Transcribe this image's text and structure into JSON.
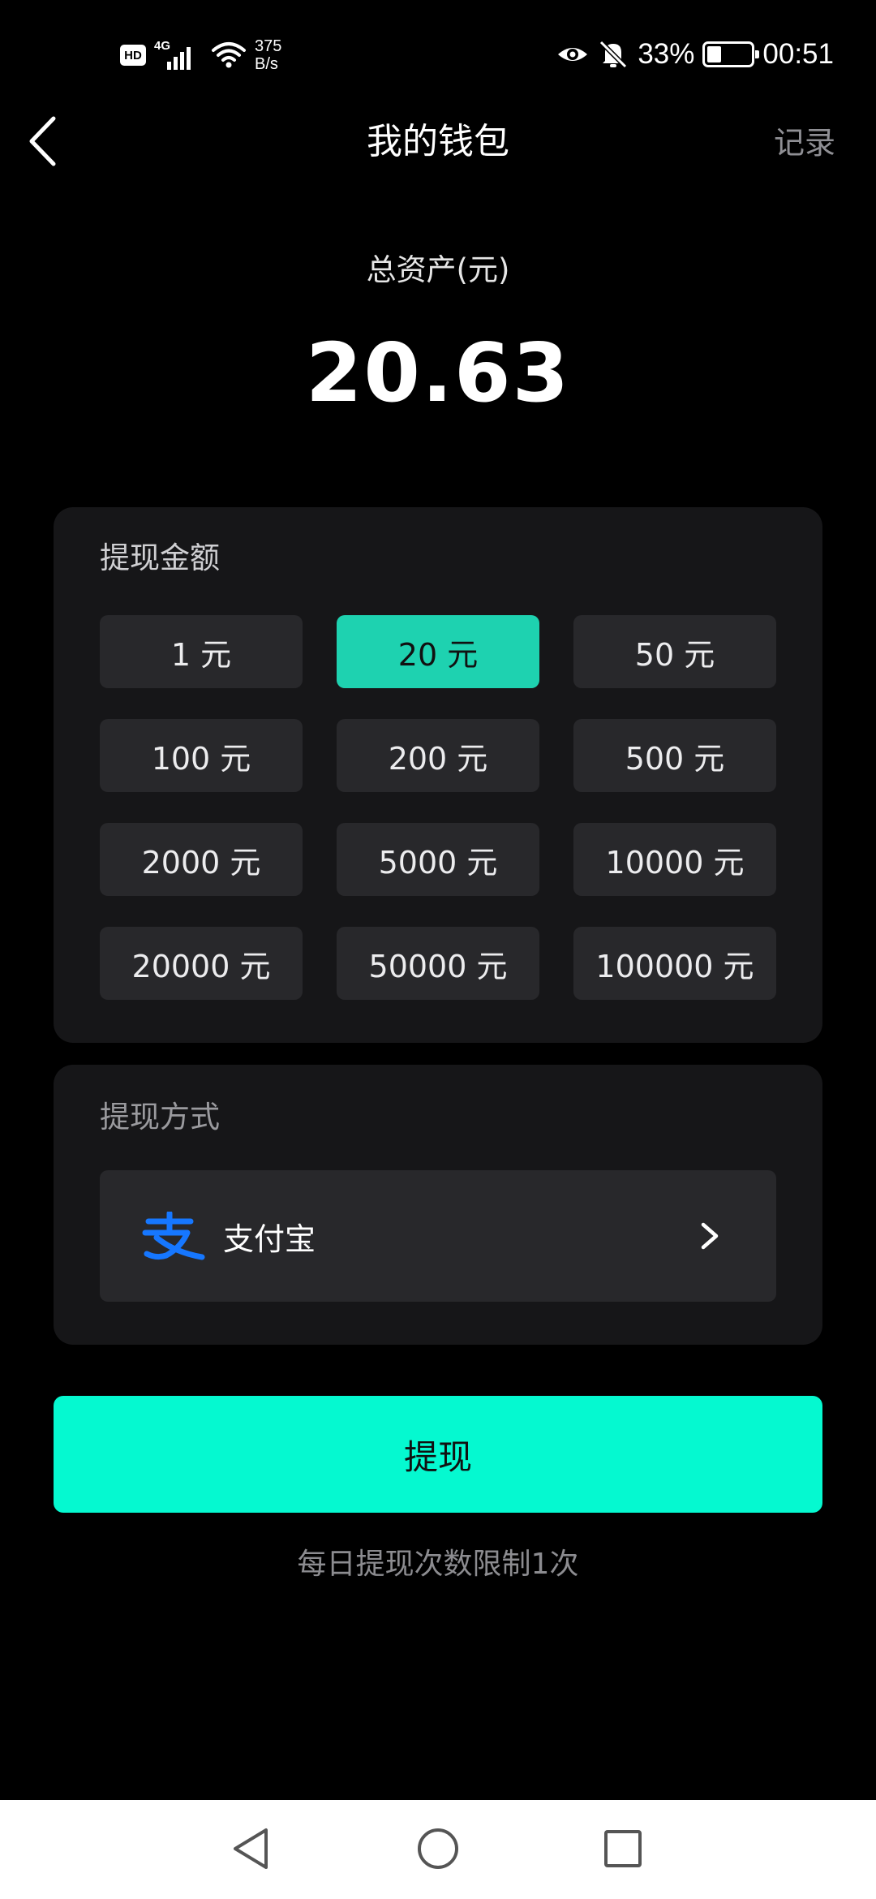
{
  "status_bar": {
    "hd": "HD",
    "network": "4G",
    "speed_value": "375",
    "speed_unit": "B/s",
    "battery_percent": "33%",
    "battery_level": 0.33,
    "time": "00:51",
    "icons": [
      "hd-icon",
      "signal-icon",
      "wifi-icon",
      "eye-icon",
      "bell-off-icon",
      "battery-icon"
    ]
  },
  "header": {
    "back_icon": "chevron-left-icon",
    "title": "我的钱包",
    "records_label": "记录"
  },
  "balance": {
    "label": "总资产(元)",
    "value": "20.63"
  },
  "withdraw_amount": {
    "title": "提现金额",
    "options": [
      {
        "label": "1 元",
        "selected": false
      },
      {
        "label": "20 元",
        "selected": true
      },
      {
        "label": "50 元",
        "selected": false
      },
      {
        "label": "100 元",
        "selected": false
      },
      {
        "label": "200 元",
        "selected": false
      },
      {
        "label": "500 元",
        "selected": false
      },
      {
        "label": "2000 元",
        "selected": false
      },
      {
        "label": "5000 元",
        "selected": false
      },
      {
        "label": "10000 元",
        "selected": false
      },
      {
        "label": "20000 元",
        "selected": false
      },
      {
        "label": "50000 元",
        "selected": false
      },
      {
        "label": "100000 元",
        "selected": false
      }
    ]
  },
  "withdraw_method": {
    "title": "提现方式",
    "method_label": "支付宝",
    "method_icon": "alipay-icon",
    "chevron_icon": "chevron-right-icon"
  },
  "withdraw_button_label": "提现",
  "limit_note": "每日提现次数限制1次",
  "colors": {
    "background": "#000000",
    "card": "#161618",
    "option": "#28282b",
    "selected_option": "#1ed2b0",
    "primary_button": "#05f9d0",
    "alipay_blue": "#1677ff"
  },
  "nav_bar": {
    "icons": [
      "nav-back-icon",
      "nav-home-icon",
      "nav-recents-icon"
    ]
  }
}
